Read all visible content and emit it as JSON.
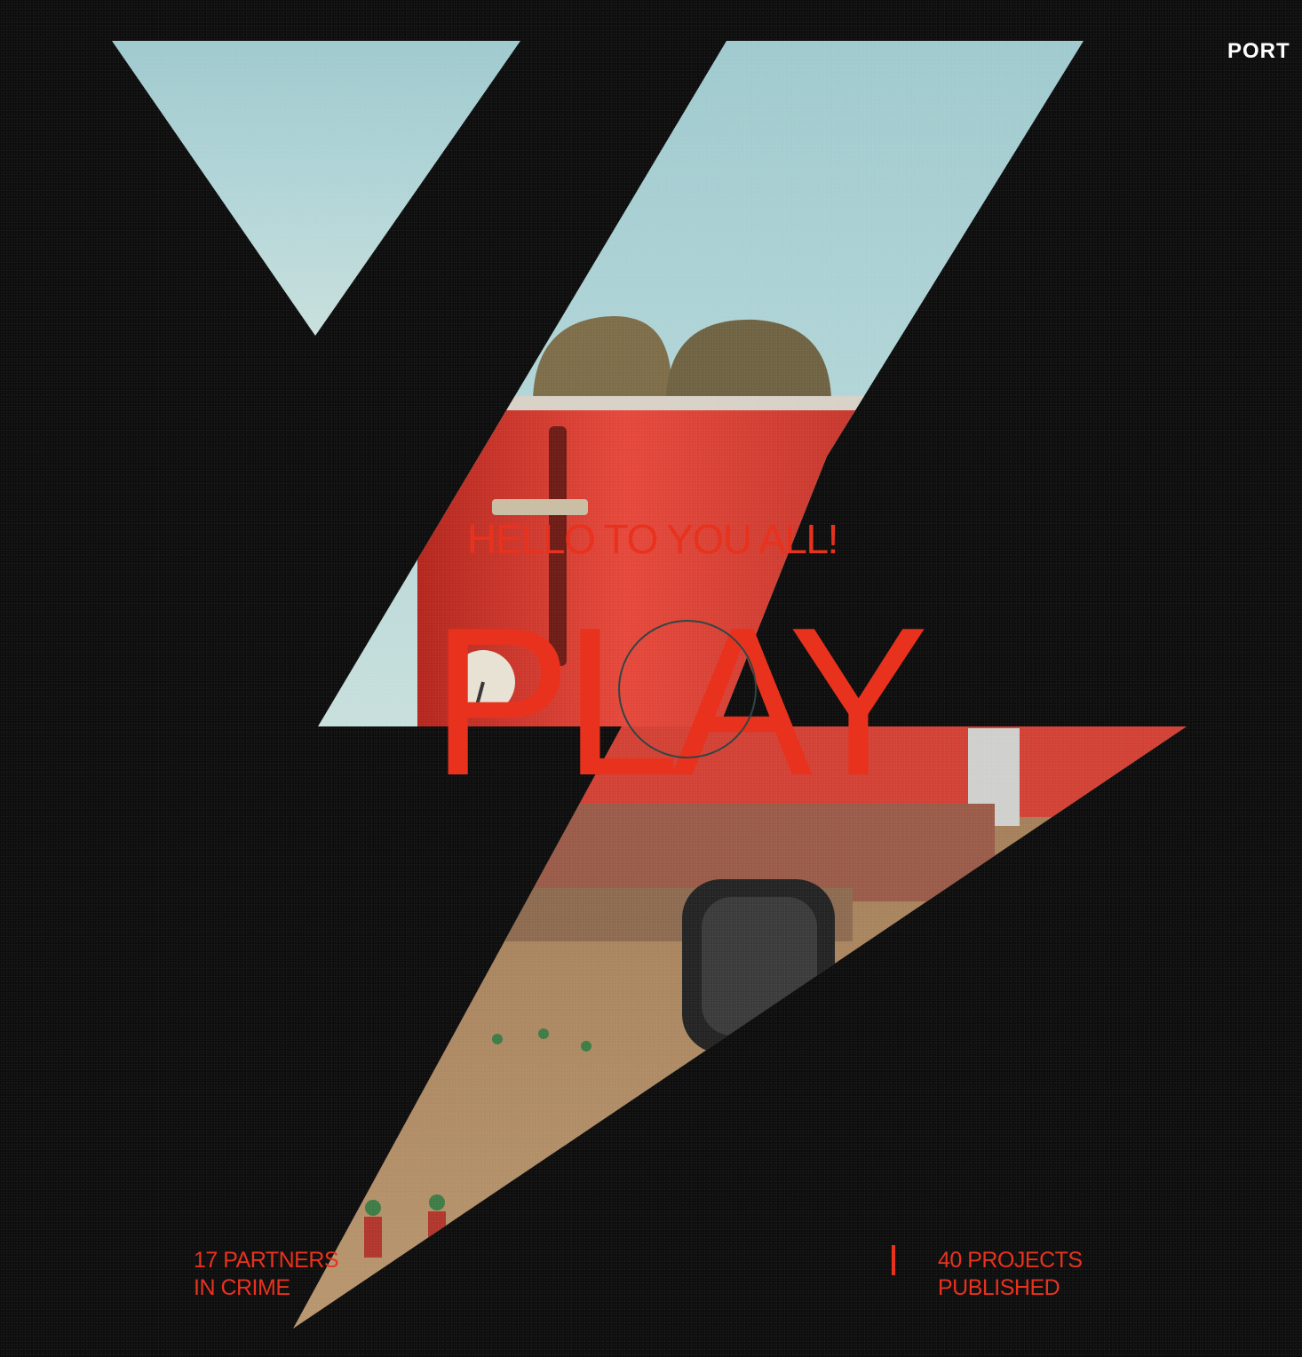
{
  "nav": {
    "portfolio_label": "PORT"
  },
  "hero": {
    "greeting": "HELLO TO YOU ALL!",
    "play_label": "PLAY"
  },
  "stats": {
    "partners": {
      "line1": "17 PARTNERS",
      "line2": "IN CRIME"
    },
    "projects": {
      "line1": "40 PROJECTS",
      "line2": "PUBLISHED"
    }
  },
  "colors": {
    "background": "#0c0c0c",
    "accent": "#e8321e",
    "sky": "#a7cfd3",
    "nav_text": "#ffffff"
  }
}
